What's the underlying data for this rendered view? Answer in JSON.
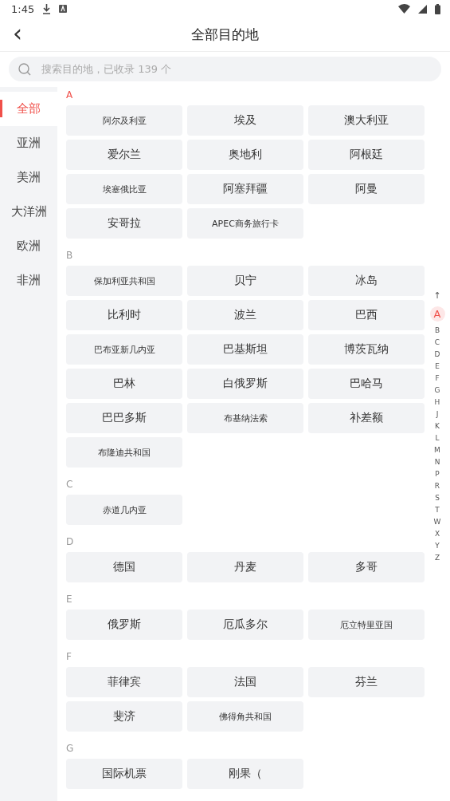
{
  "status_bar": {
    "time": "1:45"
  },
  "header": {
    "back": "‹",
    "title": "全部目的地"
  },
  "search": {
    "placeholder": "搜索目的地，已收录 139 个"
  },
  "sidebar": {
    "items": [
      {
        "label": "全部",
        "selected": true
      },
      {
        "label": "亚洲",
        "selected": false
      },
      {
        "label": "美洲",
        "selected": false
      },
      {
        "label": "大洋洲",
        "selected": false
      },
      {
        "label": "欧洲",
        "selected": false
      },
      {
        "label": "非洲",
        "selected": false
      }
    ]
  },
  "sections": [
    {
      "letter": "A",
      "selected": true,
      "items": [
        "阿尔及利亚",
        "埃及",
        "澳大利亚",
        "爱尔兰",
        "奥地利",
        "阿根廷",
        "埃塞俄比亚",
        "阿塞拜疆",
        "阿曼",
        "安哥拉",
        "APEC商务旅行卡"
      ]
    },
    {
      "letter": "B",
      "selected": false,
      "items": [
        "保加利亚共和国",
        "贝宁",
        "冰岛",
        "比利时",
        "波兰",
        "巴西",
        "巴布亚新几内亚",
        "巴基斯坦",
        "博茨瓦纳",
        "巴林",
        "白俄罗斯",
        "巴哈马",
        "巴巴多斯",
        "布基纳法索",
        "补差额",
        "布隆迪共和国"
      ]
    },
    {
      "letter": "C",
      "selected": false,
      "items": [
        "赤道几内亚"
      ]
    },
    {
      "letter": "D",
      "selected": false,
      "items": [
        "德国",
        "丹麦",
        "多哥"
      ]
    },
    {
      "letter": "E",
      "selected": false,
      "items": [
        "俄罗斯",
        "厄瓜多尔",
        "厄立特里亚国"
      ]
    },
    {
      "letter": "F",
      "selected": false,
      "items": [
        "菲律宾",
        "法国",
        "芬兰",
        "斐济",
        "佛得角共和国"
      ]
    },
    {
      "letter": "G",
      "selected": false,
      "items": [
        "国际机票",
        "刚果（"
      ]
    }
  ],
  "index": {
    "top": "↑",
    "letters": [
      {
        "label": "A",
        "selected": true
      },
      {
        "label": "B",
        "selected": false
      },
      {
        "label": "C",
        "selected": false
      },
      {
        "label": "D",
        "selected": false
      },
      {
        "label": "E",
        "selected": false
      },
      {
        "label": "F",
        "selected": false
      },
      {
        "label": "G",
        "selected": false
      },
      {
        "label": "H",
        "selected": false
      },
      {
        "label": "J",
        "selected": false
      },
      {
        "label": "K",
        "selected": false
      },
      {
        "label": "L",
        "selected": false
      },
      {
        "label": "M",
        "selected": false
      },
      {
        "label": "N",
        "selected": false
      },
      {
        "label": "P",
        "selected": false
      },
      {
        "label": "R",
        "selected": false
      },
      {
        "label": "S",
        "selected": false
      },
      {
        "label": "T",
        "selected": false
      },
      {
        "label": "W",
        "selected": false
      },
      {
        "label": "X",
        "selected": false
      },
      {
        "label": "Y",
        "selected": false
      },
      {
        "label": "Z",
        "selected": false
      }
    ]
  }
}
